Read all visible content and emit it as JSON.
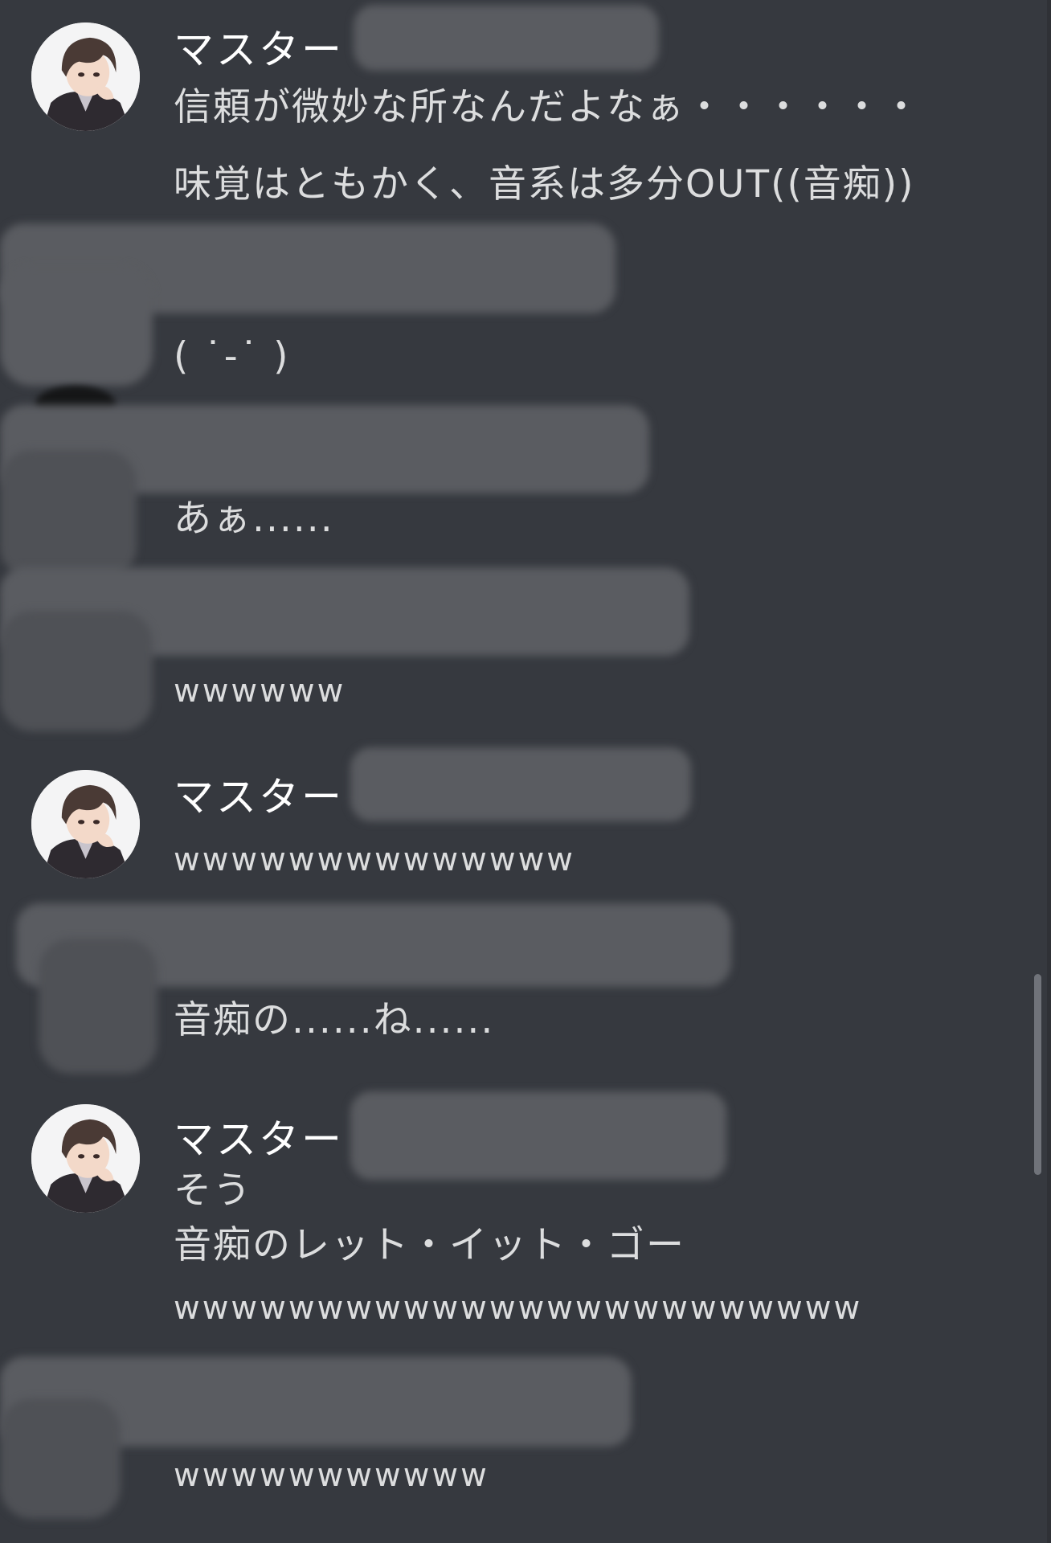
{
  "messages": [
    {
      "author": "マスター",
      "lines": [
        "信頼が微妙な所なんだよなぁ・・・・・・",
        "味覚はともかく、音系は多分OUT((音痴))"
      ]
    },
    {
      "lines": [
        "( ˙-˙ )"
      ]
    },
    {
      "lines": [
        "あぁ......"
      ]
    },
    {
      "lines": [
        "wwwwww"
      ]
    },
    {
      "author": "マスター",
      "lines": [
        "wwwwwwwwwwwwww"
      ]
    },
    {
      "lines": [
        "音痴の......ね......"
      ]
    },
    {
      "author": "マスター",
      "lines": [
        "そう",
        "音痴のレット・イット・ゴー",
        "wwwwwwwwwwwwwwwwwwwwwwww"
      ]
    },
    {
      "lines": [
        "wwwwwwwwwww"
      ]
    }
  ],
  "icons": {
    "avatar": "user-avatar-icon"
  },
  "colors": {
    "background": "#36393f",
    "text": "#dcddde",
    "username": "#ffffff",
    "redaction": "#5a5c61",
    "scrollbar": "#70737a"
  }
}
